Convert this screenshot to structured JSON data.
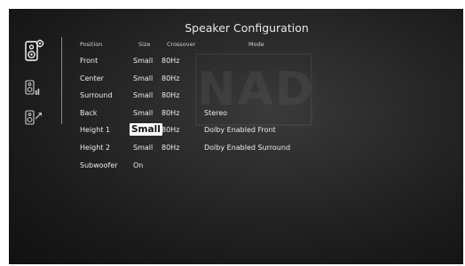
{
  "header": {
    "title": "Speaker Configuration"
  },
  "columns": {
    "position": "Position",
    "size": "Size",
    "crossover": "Crossover",
    "mode": "Mode"
  },
  "watermark": {
    "text": "NAD"
  },
  "sidebar": {
    "icons": [
      "speaker-setup-icon",
      "speaker-levels-icon",
      "speaker-distance-icon"
    ]
  },
  "rows": [
    {
      "position": "Front",
      "size": "Small",
      "crossover": "80Hz",
      "mode": ""
    },
    {
      "position": "Center",
      "size": "Small",
      "crossover": "80Hz",
      "mode": ""
    },
    {
      "position": "Surround",
      "size": "Small",
      "crossover": "80Hz",
      "mode": ""
    },
    {
      "position": "Back",
      "size": "Small",
      "crossover": "80Hz",
      "mode": "Stereo"
    },
    {
      "position": "Height 1",
      "size": "Small",
      "crossover": "80Hz",
      "mode": "Dolby Enabled Front"
    },
    {
      "position": "Height 2",
      "size": "Small",
      "crossover": "80Hz",
      "mode": "Dolby Enabled Surround"
    },
    {
      "position": "Subwoofer",
      "size": "On",
      "crossover": "",
      "mode": ""
    }
  ],
  "selection": {
    "row": 4,
    "column": "size"
  },
  "colors": {
    "text": "#ececec",
    "highlight_bg": "#ffffff",
    "highlight_text": "#111111"
  }
}
